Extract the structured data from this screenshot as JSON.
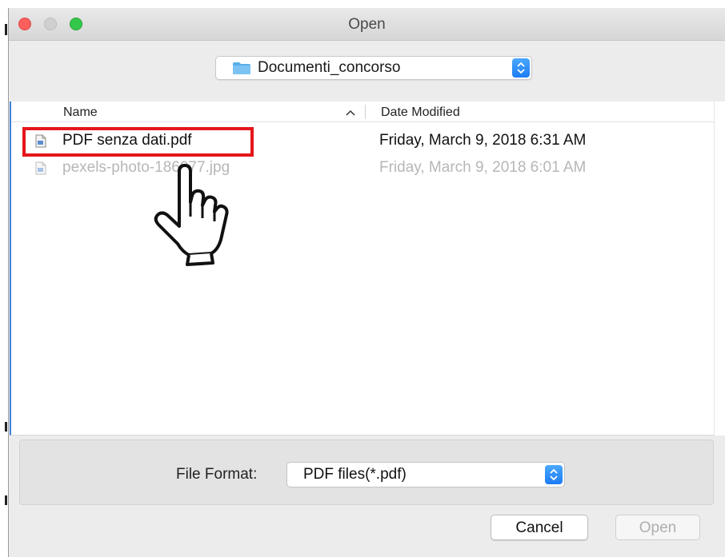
{
  "window": {
    "title": "Open"
  },
  "location": {
    "selected": "Documenti_concorso"
  },
  "columns": {
    "name": "Name",
    "date_modified": "Date Modified"
  },
  "files": [
    {
      "name": "PDF senza dati.pdf",
      "date": "Friday, March 9, 2018 6:31 AM",
      "enabled": true,
      "highlighted": true
    },
    {
      "name": "pexels-photo-186077.jpg",
      "date": "Friday, March 9, 2018 6:01 AM",
      "enabled": false,
      "highlighted": false
    }
  ],
  "file_format": {
    "label": "File Format:",
    "selected": "PDF files(*.pdf)"
  },
  "buttons": {
    "cancel": "Cancel",
    "open": "Open"
  },
  "colors": {
    "highlight": "#e4161a",
    "accent": "#1d7cf2",
    "close": "#fc605c",
    "maximize": "#34c84a"
  },
  "icons": {
    "folder": "folder-icon",
    "sort": "sort-ascending-icon",
    "file": "document-icon",
    "pointer": "hand-pointer-icon"
  }
}
